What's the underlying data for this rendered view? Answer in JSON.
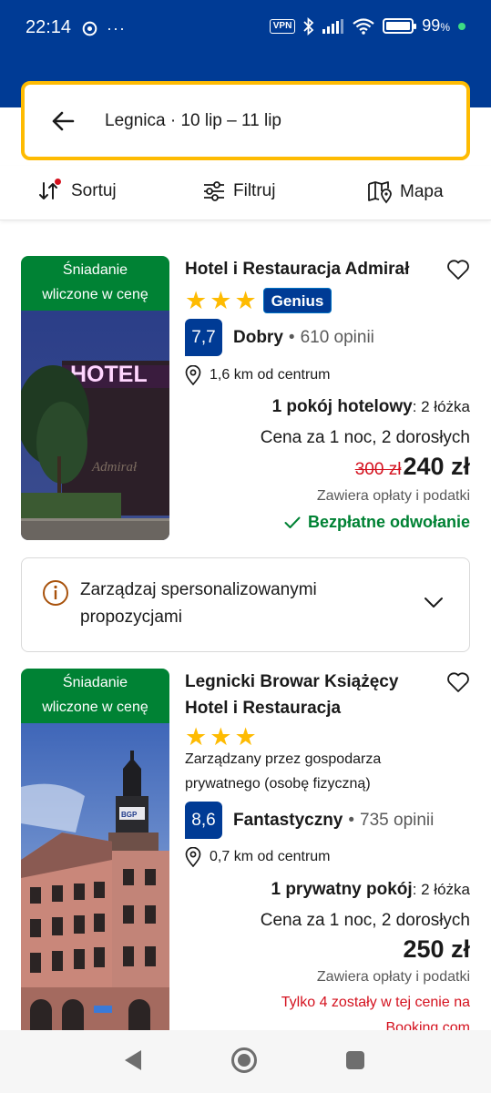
{
  "status_bar": {
    "time": "22:14",
    "more": "···",
    "vpn": "VPN",
    "battery_percent": "99",
    "battery_unit": "%",
    "battery_level": 0.99
  },
  "search": {
    "summary": "Legnica · 10 lip – 11 lip"
  },
  "toolbar": {
    "sort_label": "Sortuj",
    "filter_label": "Filtruj",
    "map_label": "Mapa"
  },
  "hotels": [
    {
      "badge_line1": "Śniadanie",
      "badge_line2": "wliczone w cenę",
      "name": "Hotel i Restauracja Admirał",
      "stars": 3,
      "genius": "Genius",
      "score": "7,7",
      "score_word": "Dobry",
      "reviews": "610 opinii",
      "distance": "1,6 km od centrum",
      "room_type": "1 pokój hotelowy",
      "beds": ": 2 łóżka",
      "price_for": "Cena za 1 noc, 2 dorosłych",
      "old_price": "300 zł",
      "price": "240 zł",
      "taxes": "Zawiera opłaty i podatki",
      "cancellation": "Bezpłatne odwołanie",
      "image_sign": "HOTEL",
      "image_script": "Admirał"
    },
    {
      "badge_line1": "Śniadanie",
      "badge_line2": "wliczone w cenę",
      "name_line1": "Legnicki Browar Książęcy",
      "name_line2": "Hotel i Restauracja",
      "stars": 3,
      "managed_line1": "Zarządzany przez gospodarza",
      "managed_line2": "prywatnego (osobę fizyczną)",
      "score": "8,6",
      "score_word": "Fantastyczny",
      "reviews": "735 opinii",
      "distance": "0,7 km od centrum",
      "room_type": "1 prywatny pokój",
      "beds": ": 2 łóżka",
      "price_for": "Cena za 1 noc, 2 dorosłych",
      "price": "250 zł",
      "taxes": "Zawiera opłaty i podatki",
      "scarcity_line1": "Tylko 4 zostały w tej cenie na",
      "scarcity_line2": "Booking.com",
      "image_sign": "BGP"
    }
  ],
  "personalized": {
    "line1": "Zarządzaj spersonalizowanymi",
    "line2": "propozycjami"
  },
  "colors": {
    "brand_blue": "#003b95",
    "genius_blue": "#003b95",
    "accent_yellow": "#febb02",
    "green": "#008234",
    "red": "#d4111e"
  }
}
